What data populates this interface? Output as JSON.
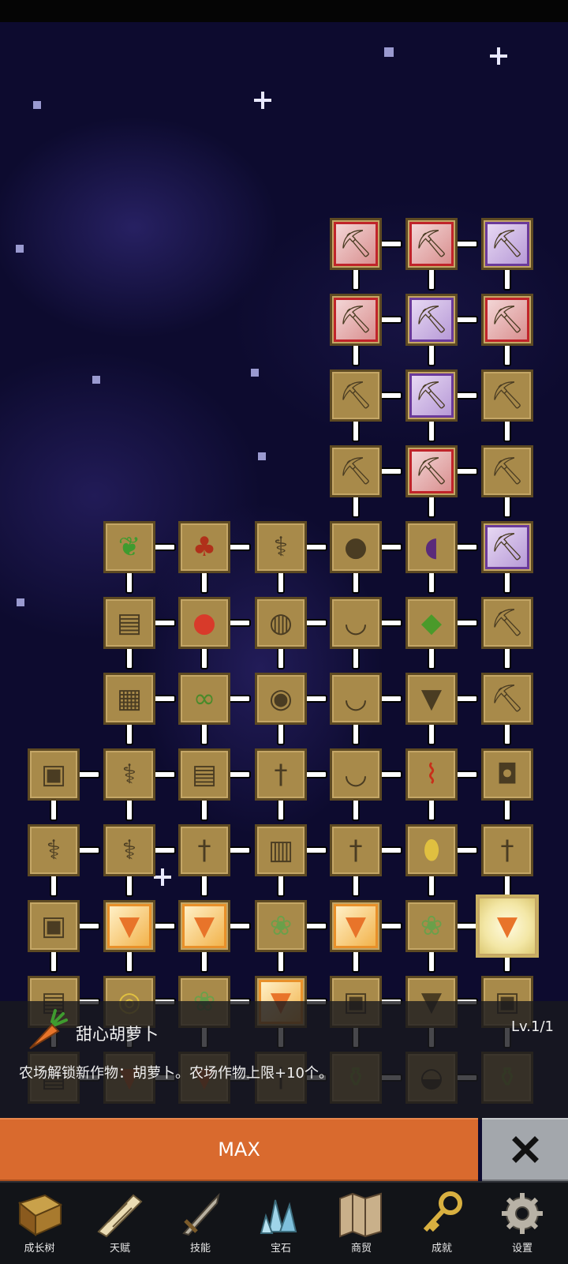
{
  "info": {
    "name": "甜心胡萝卜",
    "level": "Lv.1/1",
    "description": "农场解锁新作物：胡萝卜。农场作物上限+10个。"
  },
  "actions": {
    "max_label": "MAX",
    "close_icon": "close-icon"
  },
  "nav": {
    "items": [
      {
        "label": "成长树",
        "icon": "book-icon"
      },
      {
        "label": "天赋",
        "icon": "scroll-icon"
      },
      {
        "label": "技能",
        "icon": "sword-icon"
      },
      {
        "label": "宝石",
        "icon": "crystal-icon"
      },
      {
        "label": "商贸",
        "icon": "map-icon"
      },
      {
        "label": "成就",
        "icon": "key-icon"
      },
      {
        "label": "设置",
        "icon": "gear-icon"
      }
    ]
  },
  "colors": {
    "accent_orange": "#d96a2e",
    "close_gray": "#a3a7ac",
    "node_gold": "#a88a4a",
    "background_space": "#0d0b2f"
  }
}
